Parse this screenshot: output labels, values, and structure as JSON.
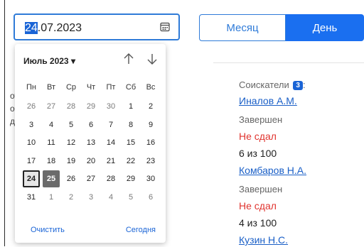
{
  "date_input": {
    "value_selected": "24",
    "value_rest": ".07.2023",
    "icon": "calendar-icon"
  },
  "view_toggle": {
    "month_label": "Месяц",
    "day_label": "День",
    "active": "day"
  },
  "picker": {
    "month_label": "Июль 2023 ▾",
    "weekdays": [
      "Пн",
      "Вт",
      "Ср",
      "Чт",
      "Пт",
      "Сб",
      "Вс"
    ],
    "weeks": [
      [
        {
          "d": "26",
          "other": true
        },
        {
          "d": "27",
          "other": true
        },
        {
          "d": "28",
          "other": true
        },
        {
          "d": "29",
          "other": true
        },
        {
          "d": "30",
          "other": true
        },
        {
          "d": "1"
        },
        {
          "d": "2"
        }
      ],
      [
        {
          "d": "3"
        },
        {
          "d": "4"
        },
        {
          "d": "5"
        },
        {
          "d": "6"
        },
        {
          "d": "7"
        },
        {
          "d": "8"
        },
        {
          "d": "9"
        }
      ],
      [
        {
          "d": "10"
        },
        {
          "d": "11"
        },
        {
          "d": "12"
        },
        {
          "d": "13"
        },
        {
          "d": "14"
        },
        {
          "d": "15"
        },
        {
          "d": "16"
        }
      ],
      [
        {
          "d": "17"
        },
        {
          "d": "18"
        },
        {
          "d": "19"
        },
        {
          "d": "20"
        },
        {
          "d": "21"
        },
        {
          "d": "22"
        },
        {
          "d": "23"
        }
      ],
      [
        {
          "d": "24",
          "today": true
        },
        {
          "d": "25",
          "selected": true
        },
        {
          "d": "26"
        },
        {
          "d": "27"
        },
        {
          "d": "28"
        },
        {
          "d": "29"
        },
        {
          "d": "30"
        }
      ],
      [
        {
          "d": "31"
        },
        {
          "d": "1",
          "other": true
        },
        {
          "d": "2",
          "other": true
        },
        {
          "d": "3",
          "other": true
        },
        {
          "d": "4",
          "other": true
        },
        {
          "d": "5",
          "other": true
        },
        {
          "d": "6",
          "other": true
        }
      ]
    ],
    "clear_label": "Очистить",
    "today_label": "Сегодня"
  },
  "background_fragments": [
    "от",
    "о",
    "д"
  ],
  "applicants": {
    "header": "Соискатели",
    "count": "3",
    "header_suffix": ":",
    "items": [
      {
        "name": "Иналов А.М.",
        "status": "Завершен",
        "result": "Не сдал",
        "score": "6 из 100"
      },
      {
        "name": "Комбаров Н.А.",
        "status": "Завершен",
        "result": "Не сдал",
        "score": "4 из 100"
      },
      {
        "name": "Кузин Н.С."
      }
    ]
  }
}
